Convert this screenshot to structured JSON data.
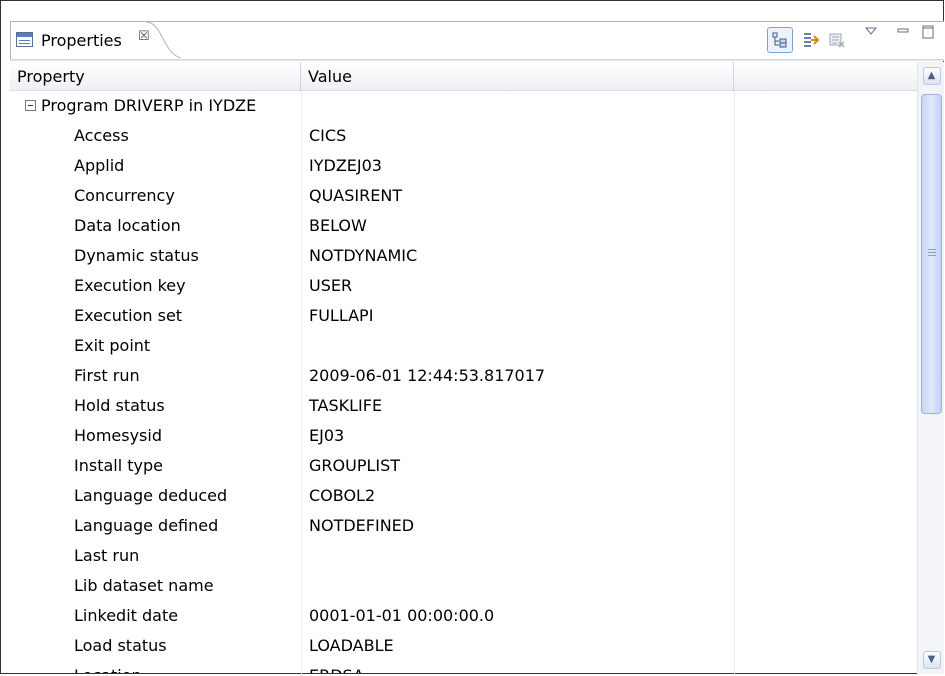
{
  "view": {
    "title": "Properties",
    "close_glyph": "☒"
  },
  "toolbar": {
    "buttons": [
      "show-categories-icon",
      "show-advanced-properties-icon",
      "restore-default-icon",
      "view-menu-icon",
      "minimize-icon",
      "maximize-icon"
    ]
  },
  "table": {
    "columns": [
      "Property",
      "Value"
    ],
    "group": "Program DRIVERP  in IYDZE",
    "rows": [
      {
        "property": "Access",
        "value": "CICS"
      },
      {
        "property": "Applid",
        "value": "IYDZEJ03"
      },
      {
        "property": "Concurrency",
        "value": "QUASIRENT"
      },
      {
        "property": "Data location",
        "value": "BELOW"
      },
      {
        "property": "Dynamic status",
        "value": "NOTDYNAMIC"
      },
      {
        "property": "Execution key",
        "value": "USER"
      },
      {
        "property": "Execution set",
        "value": "FULLAPI"
      },
      {
        "property": "Exit point",
        "value": ""
      },
      {
        "property": "First run",
        "value": "2009-06-01 12:44:53.817017"
      },
      {
        "property": "Hold status",
        "value": "TASKLIFE"
      },
      {
        "property": "Homesysid",
        "value": "EJ03"
      },
      {
        "property": "Install type",
        "value": "GROUPLIST"
      },
      {
        "property": "Language deduced",
        "value": "COBOL2"
      },
      {
        "property": "Language defined",
        "value": "NOTDEFINED"
      },
      {
        "property": "Last run",
        "value": ""
      },
      {
        "property": "Lib dataset name",
        "value": ""
      },
      {
        "property": "Linkedit date",
        "value": "0001-01-01 00:00:00.0"
      },
      {
        "property": "Load status",
        "value": "LOADABLE"
      },
      {
        "property": "Location",
        "value": "ERDSA"
      }
    ]
  },
  "scrollbar": {
    "up_glyph": "▲",
    "down_glyph": "▼"
  },
  "colors": {
    "accent": "#7fa3d7",
    "scroll_thumb": "#c7d6f1"
  }
}
